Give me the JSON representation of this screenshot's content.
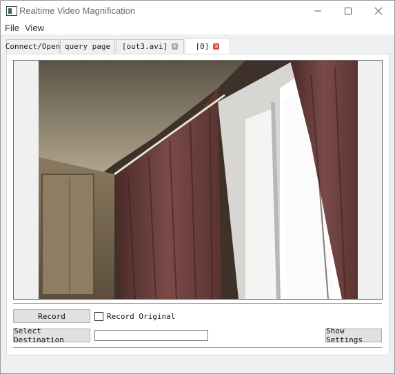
{
  "window": {
    "title": "Realtime Video Magnification"
  },
  "menu": [
    {
      "label": "File"
    },
    {
      "label": "View"
    }
  ],
  "tabs": [
    {
      "label": "Connect/Open"
    },
    {
      "label": "query page"
    },
    {
      "label": "[out3.avi]",
      "closable": true
    },
    {
      "label": "[0]",
      "closable": true,
      "active": true
    }
  ],
  "controls": {
    "record_label": "Record",
    "record_original_label": "Record Original",
    "record_original_checked": false,
    "select_destination_label": "Select Destination",
    "destination_value": "",
    "show_settings_label": "Show Settings"
  },
  "icons": {
    "minimize": "minimize-icon",
    "maximize": "maximize-icon",
    "close": "close-icon",
    "tab_close": "tab-close-icon"
  },
  "colors": {
    "tab_close_active": "#e04a3f",
    "tab_close_inactive": "#a8a8a8"
  }
}
